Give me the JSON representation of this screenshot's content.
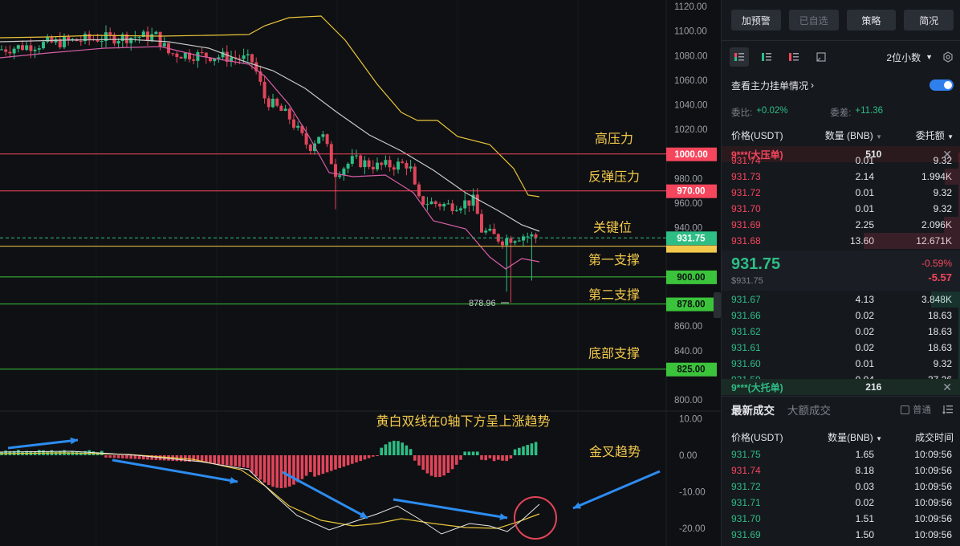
{
  "chart": {
    "price_axis": [
      "1120.00",
      "1100.00",
      "1080.00",
      "1060.00",
      "1040.00",
      "1020.00",
      "980.00",
      "960.00",
      "940.00",
      "860.00",
      "840.00",
      "800.00"
    ],
    "macd_axis": [
      "10.00",
      "0.00",
      "-10.00",
      "-20.00"
    ],
    "levels": [
      {
        "price": "1000.00",
        "label": "高压力",
        "color": "#f6465d"
      },
      {
        "price": "970.00",
        "label": "反弹压力",
        "color": "#f6465d"
      },
      {
        "price": "931.75",
        "label": "关键位",
        "color": "#2ebd85"
      },
      {
        "price": "900.00",
        "label": "第一支撑",
        "color": "#3bc43b"
      },
      {
        "price": "878.00",
        "label": "第二支撑",
        "color": "#3bc43b"
      },
      {
        "price": "825.00",
        "label": "底部支撑",
        "color": "#3bc43b"
      }
    ],
    "min_label": "878.96",
    "macd_note": "黄白双线在0轴下方呈上涨趋势",
    "golden_cross": "金叉趋势"
  },
  "panel": {
    "buttons": [
      "加预警",
      "已自选",
      "策略",
      "简况"
    ],
    "decimals": "2位小数",
    "main_force": "查看主力挂单情况",
    "weibi_label": "委比:",
    "weibi_value": "+0.02%",
    "weicha_label": "委差:",
    "weicha_value": "+11.36",
    "col_price": "价格(USDT)",
    "col_qty": "数量 (BNB)",
    "col_total": "委托额",
    "big_sell": {
      "tag": "9***(大压单)",
      "qty": "510"
    },
    "asks": [
      {
        "price": "931.74",
        "qty": "0.01",
        "total": "9.32"
      },
      {
        "price": "931.73",
        "qty": "2.14",
        "total": "1.994K"
      },
      {
        "price": "931.72",
        "qty": "0.01",
        "total": "9.32"
      },
      {
        "price": "931.70",
        "qty": "0.01",
        "total": "9.32"
      },
      {
        "price": "931.69",
        "qty": "2.25",
        "total": "2.096K"
      },
      {
        "price": "931.68",
        "qty": "13.60",
        "total": "12.671K"
      }
    ],
    "last": {
      "price": "931.75",
      "usd": "$931.75",
      "pct": "-0.59%",
      "chg": "-5.57"
    },
    "bids": [
      {
        "price": "931.67",
        "qty": "4.13",
        "total": "3.848K"
      },
      {
        "price": "931.66",
        "qty": "0.02",
        "total": "18.63"
      },
      {
        "price": "931.62",
        "qty": "0.02",
        "total": "18.63"
      },
      {
        "price": "931.61",
        "qty": "0.02",
        "total": "18.63"
      },
      {
        "price": "931.60",
        "qty": "0.01",
        "total": "9.32"
      },
      {
        "price": "931.59",
        "qty": "0.04",
        "total": "37.26"
      }
    ],
    "big_buy": {
      "tag": "9***(大托单)",
      "qty": "216"
    },
    "tab_latest": "最新成交",
    "tab_large": "大额成交",
    "normal_label": "普通",
    "trade_col_price": "价格(USDT)",
    "trade_col_qty": "数量(BNB)",
    "trade_col_time": "成交时间",
    "trades": [
      {
        "price": "931.75",
        "qty": "1.65",
        "time": "10:09:56",
        "side": "buy"
      },
      {
        "price": "931.74",
        "qty": "8.18",
        "time": "10:09:56",
        "side": "sell"
      },
      {
        "price": "931.72",
        "qty": "0.03",
        "time": "10:09:56",
        "side": "buy"
      },
      {
        "price": "931.71",
        "qty": "0.02",
        "time": "10:09:56",
        "side": "buy"
      },
      {
        "price": "931.70",
        "qty": "1.51",
        "time": "10:09:56",
        "side": "buy"
      },
      {
        "price": "931.69",
        "qty": "1.50",
        "time": "10:09:56",
        "side": "buy"
      }
    ]
  }
}
